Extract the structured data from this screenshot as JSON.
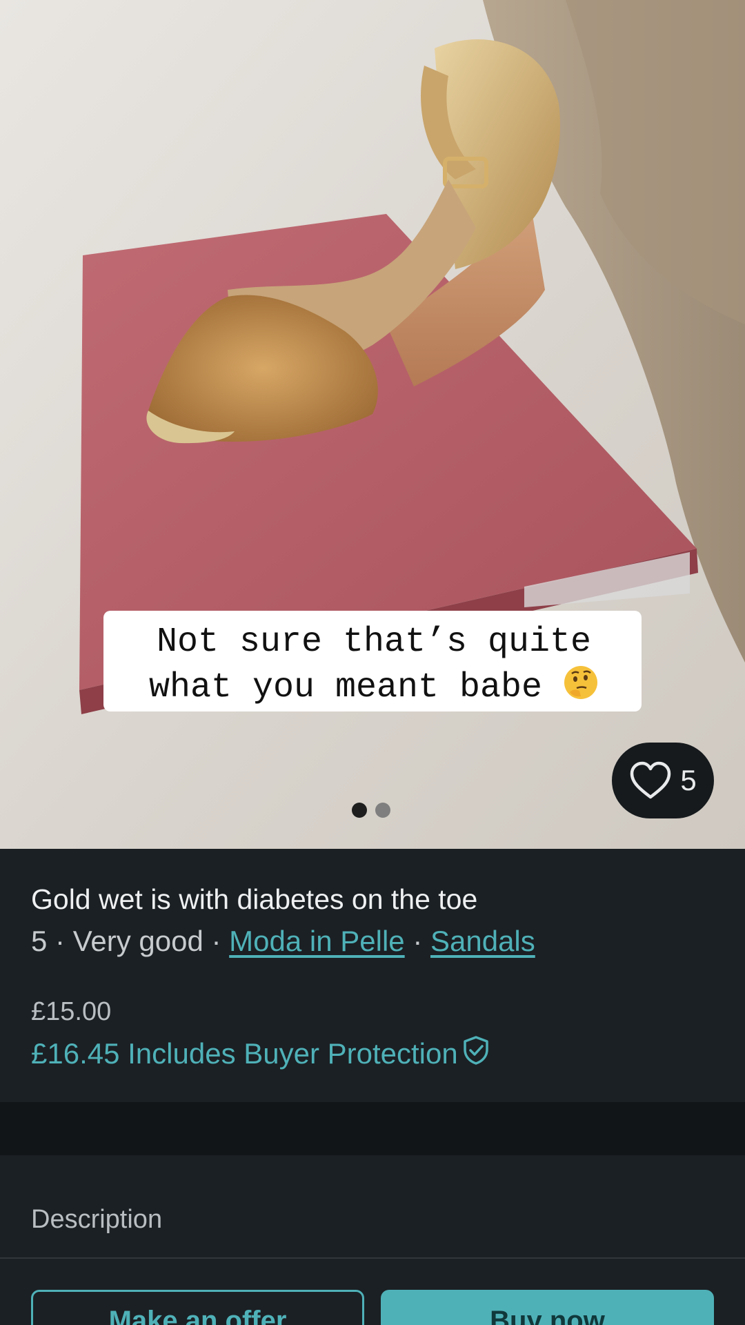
{
  "photo": {
    "caption_line1": "Not sure that’s quite",
    "caption_line2": "what you meant babe",
    "caption_emoji": "🤔",
    "favourite_count": "5",
    "carousel_total": 2,
    "carousel_active": 1
  },
  "item": {
    "title": "Gold wet is with diabetes on the toe",
    "size": "5",
    "condition": "Very good",
    "brand": "Moda in Pelle",
    "category": "Sandals",
    "separator": " · ",
    "price": "£15.00",
    "buyer_price": "£16.45 Includes Buyer Protection"
  },
  "description": {
    "label": "Description"
  },
  "actions": {
    "make_offer": "Make an offer",
    "buy_now": "Buy now"
  },
  "colors": {
    "accent": "#4fb1b8",
    "background": "#1b2024",
    "separator_band": "#111518"
  },
  "icons": {
    "favourite": "heart-outline-icon",
    "protection": "shield-check-icon"
  }
}
